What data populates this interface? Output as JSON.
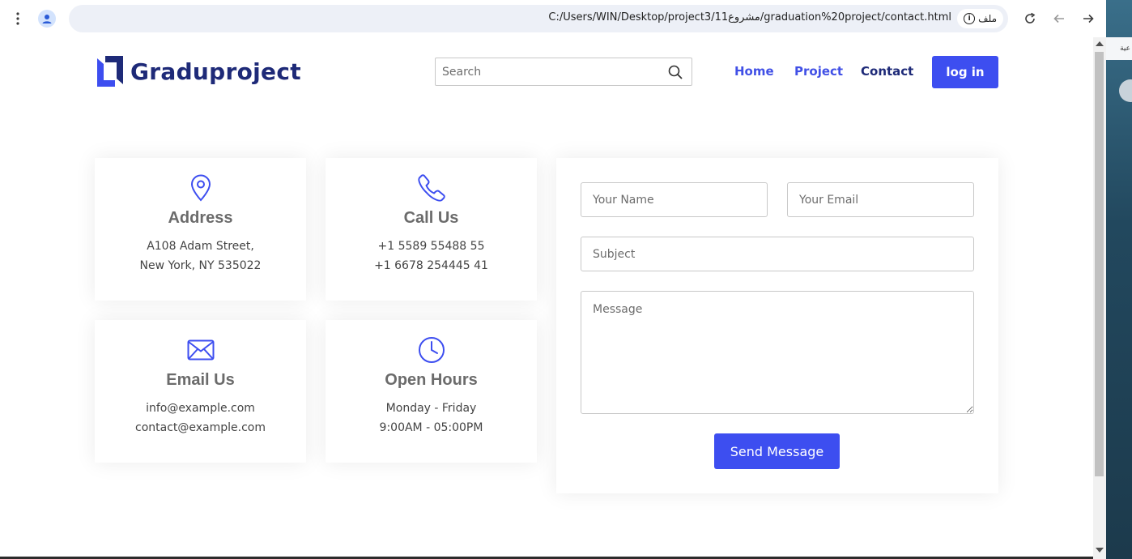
{
  "browser": {
    "url": "C:/Users/WIN/Desktop/project3/11مشروع/graduation%20project/contact.html",
    "chip_label": "ملف",
    "side_text": "عية"
  },
  "header": {
    "logo_text": "Graduproject",
    "search_placeholder": "Search",
    "nav": {
      "home": "Home",
      "project": "Project",
      "contact": "Contact"
    },
    "login_label": "log in"
  },
  "cards": {
    "address": {
      "title": "Address",
      "line1": "A108 Adam Street,",
      "line2": "New York, NY 535022",
      "icon": "map-pin-icon"
    },
    "call": {
      "title": "Call Us",
      "line1": "+1 5589 55488 55",
      "line2": "+1 6678 254445 41",
      "icon": "phone-icon"
    },
    "email": {
      "title": "Email Us",
      "line1": "info@example.com",
      "line2": "contact@example.com",
      "icon": "envelope-icon"
    },
    "hours": {
      "title": "Open Hours",
      "line1": "Monday - Friday",
      "line2": "9:00AM - 05:00PM",
      "icon": "clock-icon"
    }
  },
  "form": {
    "name_placeholder": "Your Name",
    "email_placeholder": "Your Email",
    "subject_placeholder": "Subject",
    "message_placeholder": "Message",
    "send_label": "Send Message"
  },
  "colors": {
    "accent": "#3d4ef0",
    "brand_dark": "#1e2a78",
    "nav_link": "#4150e6"
  }
}
